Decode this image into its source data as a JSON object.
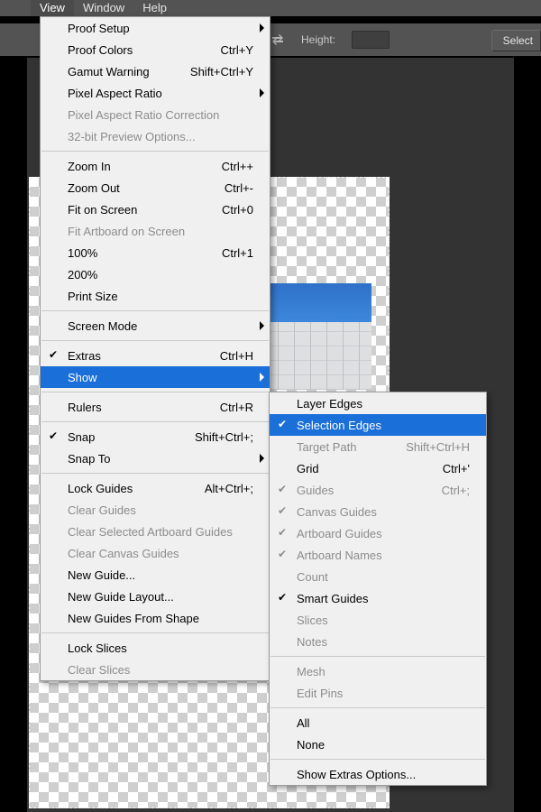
{
  "menubar": {
    "items": [
      "View",
      "Window",
      "Help"
    ],
    "active_index": 0
  },
  "toolbar": {
    "height_label": "Height:",
    "select_button": "Select"
  },
  "view_menu": [
    {
      "type": "item",
      "label": "Proof Setup",
      "submenu": true
    },
    {
      "type": "item",
      "label": "Proof Colors",
      "shortcut": "Ctrl+Y"
    },
    {
      "type": "item",
      "label": "Gamut Warning",
      "shortcut": "Shift+Ctrl+Y"
    },
    {
      "type": "item",
      "label": "Pixel Aspect Ratio",
      "submenu": true
    },
    {
      "type": "item",
      "label": "Pixel Aspect Ratio Correction",
      "disabled": true
    },
    {
      "type": "item",
      "label": "32-bit Preview Options...",
      "disabled": true
    },
    {
      "type": "sep"
    },
    {
      "type": "item",
      "label": "Zoom In",
      "shortcut": "Ctrl++"
    },
    {
      "type": "item",
      "label": "Zoom Out",
      "shortcut": "Ctrl+-"
    },
    {
      "type": "item",
      "label": "Fit on Screen",
      "shortcut": "Ctrl+0"
    },
    {
      "type": "item",
      "label": "Fit Artboard on Screen",
      "disabled": true
    },
    {
      "type": "item",
      "label": "100%",
      "shortcut": "Ctrl+1"
    },
    {
      "type": "item",
      "label": "200%"
    },
    {
      "type": "item",
      "label": "Print Size"
    },
    {
      "type": "sep"
    },
    {
      "type": "item",
      "label": "Screen Mode",
      "submenu": true
    },
    {
      "type": "sep"
    },
    {
      "type": "item",
      "label": "Extras",
      "shortcut": "Ctrl+H",
      "checked": true
    },
    {
      "type": "item",
      "label": "Show",
      "submenu": true,
      "highlight": true
    },
    {
      "type": "sep"
    },
    {
      "type": "item",
      "label": "Rulers",
      "shortcut": "Ctrl+R"
    },
    {
      "type": "sep"
    },
    {
      "type": "item",
      "label": "Snap",
      "shortcut": "Shift+Ctrl+;",
      "checked": true
    },
    {
      "type": "item",
      "label": "Snap To",
      "submenu": true
    },
    {
      "type": "sep"
    },
    {
      "type": "item",
      "label": "Lock Guides",
      "shortcut": "Alt+Ctrl+;"
    },
    {
      "type": "item",
      "label": "Clear Guides",
      "disabled": true
    },
    {
      "type": "item",
      "label": "Clear Selected Artboard Guides",
      "disabled": true
    },
    {
      "type": "item",
      "label": "Clear Canvas Guides",
      "disabled": true
    },
    {
      "type": "item",
      "label": "New Guide..."
    },
    {
      "type": "item",
      "label": "New Guide Layout..."
    },
    {
      "type": "item",
      "label": "New Guides From Shape"
    },
    {
      "type": "sep"
    },
    {
      "type": "item",
      "label": "Lock Slices"
    },
    {
      "type": "item",
      "label": "Clear Slices",
      "disabled": true
    }
  ],
  "show_submenu": [
    {
      "type": "item",
      "label": "Layer Edges"
    },
    {
      "type": "item",
      "label": "Selection Edges",
      "checked": true,
      "highlight": true
    },
    {
      "type": "item",
      "label": "Target Path",
      "shortcut": "Shift+Ctrl+H",
      "disabled": true
    },
    {
      "type": "item",
      "label": "Grid",
      "shortcut": "Ctrl+'"
    },
    {
      "type": "item",
      "label": "Guides",
      "shortcut": "Ctrl+;",
      "checked": true,
      "disabled": true
    },
    {
      "type": "item",
      "label": "Canvas Guides",
      "checked": true,
      "disabled": true
    },
    {
      "type": "item",
      "label": "Artboard Guides",
      "checked": true,
      "disabled": true
    },
    {
      "type": "item",
      "label": "Artboard Names",
      "checked": true,
      "disabled": true
    },
    {
      "type": "item",
      "label": "Count",
      "disabled": true
    },
    {
      "type": "item",
      "label": "Smart Guides",
      "checked": true
    },
    {
      "type": "item",
      "label": "Slices",
      "disabled": true
    },
    {
      "type": "item",
      "label": "Notes",
      "disabled": true
    },
    {
      "type": "sep"
    },
    {
      "type": "item",
      "label": "Mesh",
      "disabled": true
    },
    {
      "type": "item",
      "label": "Edit Pins",
      "disabled": true
    },
    {
      "type": "sep"
    },
    {
      "type": "item",
      "label": "All"
    },
    {
      "type": "item",
      "label": "None"
    },
    {
      "type": "sep"
    },
    {
      "type": "item",
      "label": "Show Extras Options..."
    }
  ]
}
